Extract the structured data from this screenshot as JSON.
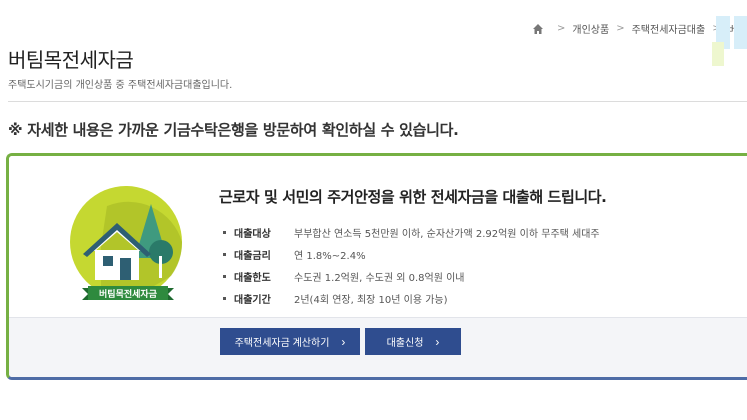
{
  "breadcrumb": {
    "items": [
      "개인상품",
      "주택전세자금대출",
      "버팀목전"
    ]
  },
  "page": {
    "title": "버팀목전세자금",
    "description": "주택도시기금의 개인상품 중 주택전세자금대출입니다."
  },
  "notice": "※ 자세한 내용은 가까운 기금수탁은행을 방문하여 확인하실 수 있습니다.",
  "product": {
    "emblem_label": "버팀목전세자금",
    "headline": "근로자 및 서민의 주거안정을 위한 전세자금을 대출해 드립니다.",
    "specs": [
      {
        "key": "대출대상",
        "value": "부부합산 연소득 5천만원 이하, 순자산가액 2.92억원 이하 무주택 세대주"
      },
      {
        "key": "대출금리",
        "value": "연 1.8%~2.4%"
      },
      {
        "key": "대출한도",
        "value": "수도권 1.2억원, 수도권 외 0.8억원 이내"
      },
      {
        "key": "대출기간",
        "value": "2년(4회 연장, 최장 10년 이용 가능)"
      }
    ],
    "buttons": {
      "calc_label": "주택전세자금 계산하기",
      "apply_label": "대출신청"
    }
  },
  "colors": {
    "accent_green": "#76b043",
    "accent_navy": "#2f4d8f",
    "emblem_circle": "#c5d831"
  },
  "icons": [
    "home-icon",
    "chevron-right-icon"
  ]
}
